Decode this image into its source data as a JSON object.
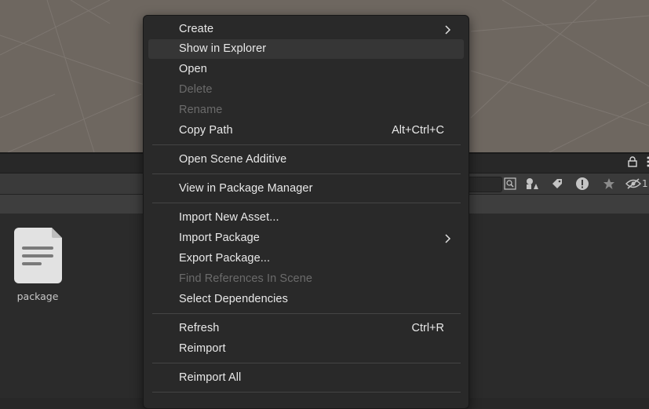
{
  "project": {
    "asset_name": "package"
  },
  "icons": {
    "lock": "lock-icon",
    "more": "more-vertical-icon",
    "search_in_scene": "search-scene-icon",
    "filter_type": "filter-by-type-icon",
    "filter_label": "filter-by-label-icon",
    "warnings": "warning-icon",
    "favorite": "star-icon",
    "hidden": "eye-slash-icon"
  },
  "hidden_count": "1",
  "menu": {
    "create": "Create",
    "show_in_explorer": "Show in Explorer",
    "open": "Open",
    "delete": "Delete",
    "rename": "Rename",
    "copy_path": "Copy Path",
    "copy_path_shortcut": "Alt+Ctrl+C",
    "open_scene_additive": "Open Scene Additive",
    "view_in_package_manager": "View in Package Manager",
    "import_new_asset": "Import New Asset...",
    "import_package": "Import Package",
    "export_package": "Export Package...",
    "find_references": "Find References In Scene",
    "select_dependencies": "Select Dependencies",
    "refresh": "Refresh",
    "refresh_shortcut": "Ctrl+R",
    "reimport": "Reimport",
    "reimport_all": "Reimport All"
  },
  "colors": {
    "menu_bg": "#292929",
    "menu_text": "#e9e9e9",
    "menu_disabled": "#6b6b6b",
    "menu_highlight": "#363636",
    "scene_bg": "#6e6760"
  }
}
